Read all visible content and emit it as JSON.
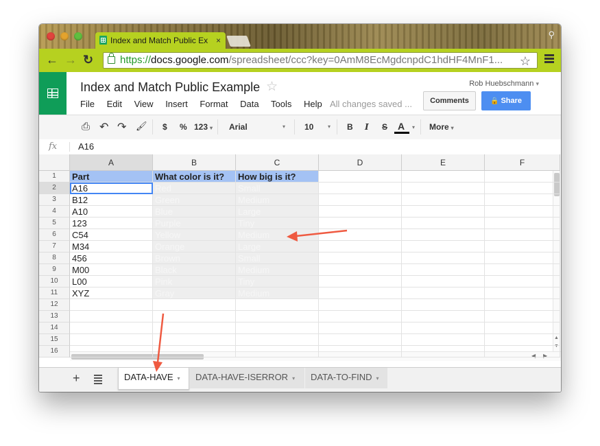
{
  "browser": {
    "tab_title": "Index and Match Public Ex",
    "tab_close": "×",
    "url_scheme": "https://",
    "url_host": "docs.google.com",
    "url_path": "/spreadsheet/ccc?key=0AmM8EcMgdcnpdC1hdHF4MnF1...",
    "back_icon": "←",
    "forward_icon": "→",
    "reload_icon": "↻",
    "star_icon": "☆",
    "user_icon": "⚲"
  },
  "doc": {
    "title": "Index and Match Public Example",
    "star": "☆",
    "menus": [
      "File",
      "Edit",
      "View",
      "Insert",
      "Format",
      "Data",
      "Tools",
      "Help"
    ],
    "save_status": "All changes saved ...",
    "user_name": "Rob Huebschmann",
    "user_caret": "▾",
    "comments_label": "Comments",
    "share_label": "Share",
    "share_icon": "🔒"
  },
  "toolbar": {
    "print": "⎙",
    "undo": "↶",
    "redo": "↷",
    "paint": "🖌",
    "currency": "$",
    "percent": "%",
    "number_format": "123",
    "font": "Arial",
    "size": "10",
    "bold": "B",
    "italic": "I",
    "strike": "S",
    "text_color": "A",
    "more": "More",
    "caret": "▾"
  },
  "formula": {
    "fx": "fx",
    "value": "A16"
  },
  "grid": {
    "columns": [
      "A",
      "B",
      "C",
      "D",
      "E",
      "F"
    ],
    "rows": [
      "1",
      "2",
      "3",
      "4",
      "5",
      "6",
      "7",
      "8",
      "9",
      "10",
      "11",
      "12",
      "13",
      "14",
      "15",
      "16"
    ],
    "header_row": [
      "Part",
      "What color is it?",
      "How big is it?"
    ],
    "parts": [
      "A16",
      "B12",
      "A10",
      "123",
      "C54",
      "M34",
      "456",
      "M00",
      "L00",
      "XYZ"
    ],
    "hidden_b": [
      "Red",
      "Green",
      "Blue",
      "Purple",
      "Yellow",
      "Orange",
      "Brown",
      "Black",
      "Pink",
      "Gray"
    ],
    "hidden_c": [
      "Small",
      "Medium",
      "Large",
      "Tiny",
      "Medium",
      "Large",
      "Small",
      "Medium",
      "Tiny",
      "Medium"
    ],
    "selected_cell": "A2"
  },
  "sheets": {
    "add": "+",
    "tabs": [
      "DATA-HAVE",
      "DATA-HAVE-ISERROR",
      "DATA-TO-FIND"
    ],
    "active": "DATA-HAVE",
    "dropdown": "▾"
  },
  "colors": {
    "chrome_green": "#b6d120",
    "sheets_green": "#0f9d58",
    "header_fill": "#a4c2f4",
    "share_blue": "#4d8ef1",
    "arrow": "#ef5a41"
  }
}
